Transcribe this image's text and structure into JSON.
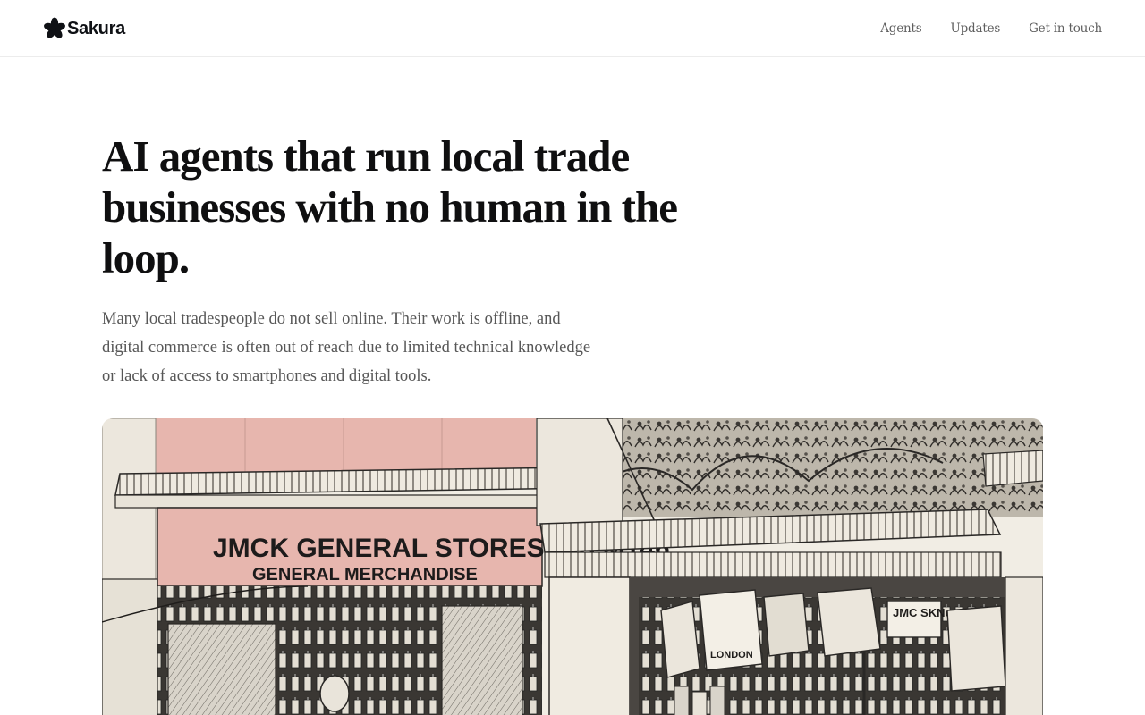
{
  "header": {
    "brand": {
      "name": "Sakura",
      "icon": "sakura-flower-icon"
    },
    "nav": [
      {
        "label": "Agents"
      },
      {
        "label": "Updates"
      },
      {
        "label": "Get in touch"
      }
    ]
  },
  "hero": {
    "title": "AI agents that run local trade businesses with no human in the loop.",
    "body": "Many local tradespeople do not sell online. Their work is offline, and digital commerce is often out of reach due to limited technical knowledge or lack of access to smartphones and digital tools."
  },
  "illustration": {
    "sign_line_1": "JMCK GENERAL STORES, No M146",
    "sign_line_2": "GENERAL  MERCHANDISE",
    "side_sign": "JMC SKNo",
    "bag_label": "LONDON",
    "colors": {
      "sign_pink": "#e7b6ae",
      "paper": "#f1ede4",
      "ink": "#2a2826"
    }
  }
}
